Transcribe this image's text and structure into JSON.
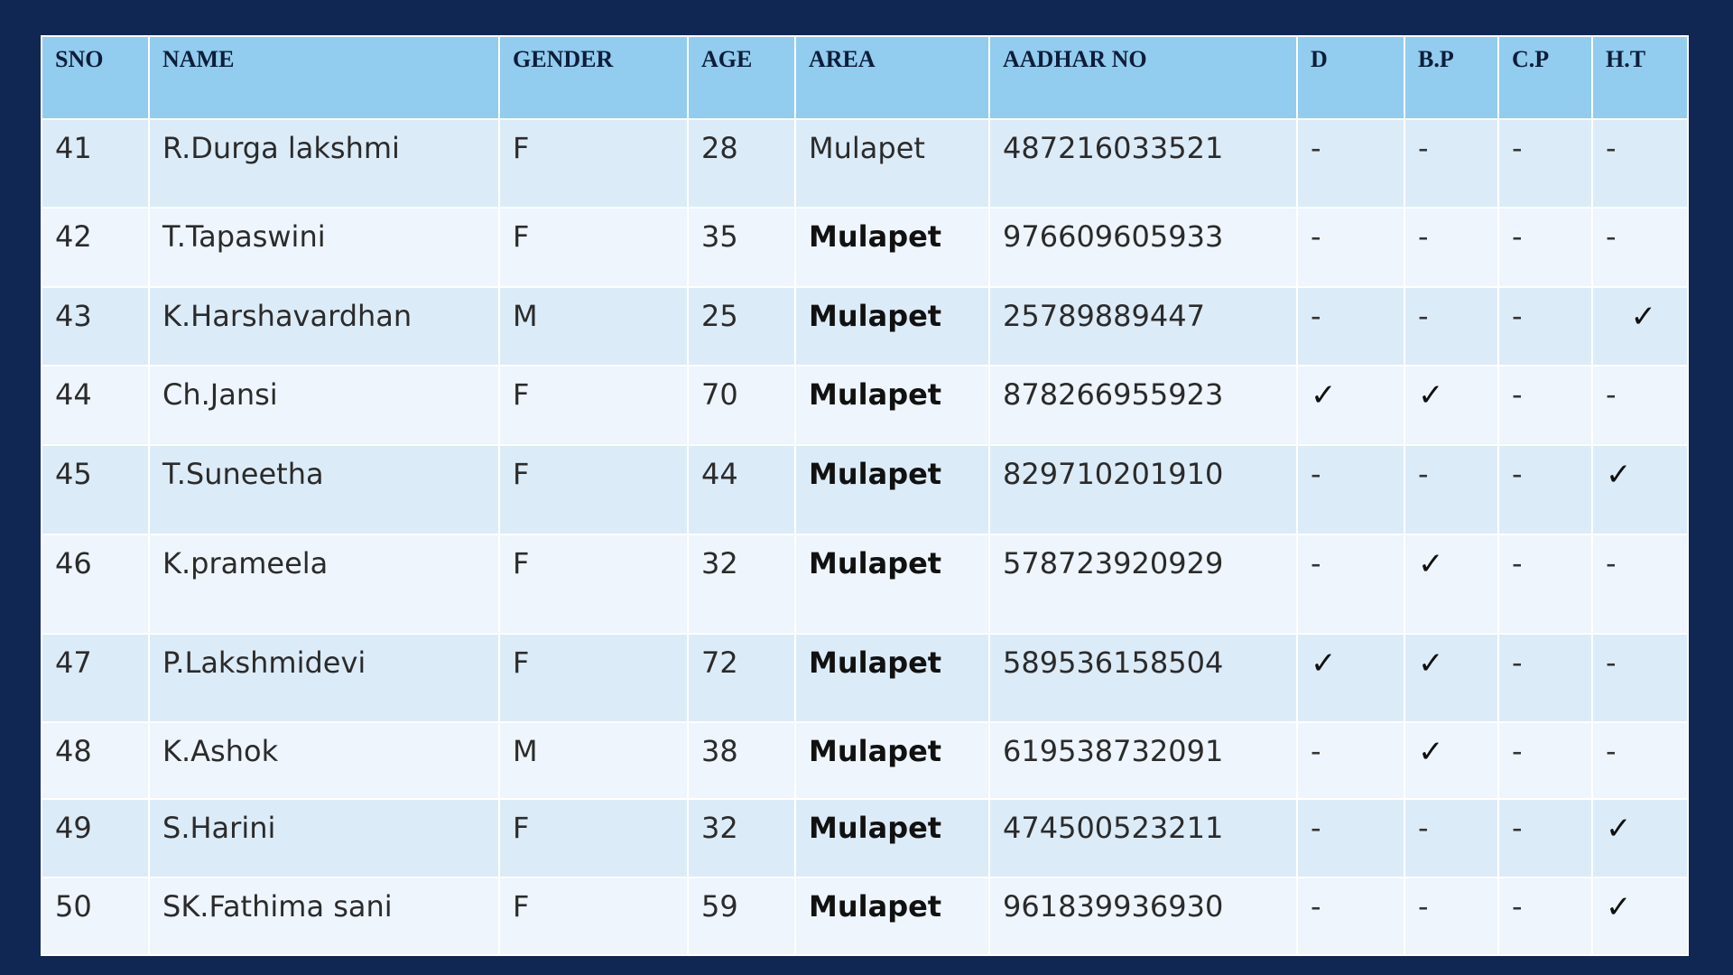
{
  "columns": [
    "SNO",
    "NAME",
    "GENDER",
    "AGE",
    "AREA",
    "AADHAR NO",
    "D",
    "B.P",
    "C.P",
    "H.T"
  ],
  "rows": [
    {
      "sno": "41",
      "name": "R.Durga lakshmi",
      "gender": "F",
      "age": "28",
      "area": "Mulapet",
      "area_bold": false,
      "aadhar": "487216033521",
      "d": "-",
      "bp": "-",
      "cp": "-",
      "ht": "-"
    },
    {
      "sno": "42",
      "name": "T.Tapaswini",
      "gender": "F",
      "age": "35",
      "area": "Mulapet",
      "area_bold": true,
      "aadhar": "976609605933",
      "d": "-",
      "bp": "-",
      "cp": "-",
      "ht": "-"
    },
    {
      "sno": "43",
      "name": "K.Harshavardhan",
      "gender": "M",
      "age": "25",
      "area": "Mulapet",
      "area_bold": true,
      "aadhar": "25789889447",
      "d": "-",
      "bp": "-",
      "cp": "-",
      "ht": "✓"
    },
    {
      "sno": "44",
      "name": "Ch.Jansi",
      "gender": "F",
      "age": "70",
      "area": "Mulapet",
      "area_bold": true,
      "aadhar": "878266955923",
      "d": "✓",
      "bp": "✓",
      "cp": "-",
      "ht": "-"
    },
    {
      "sno": "45",
      "name": "T.Suneetha",
      "gender": "F",
      "age": "44",
      "area": "Mulapet",
      "area_bold": true,
      "aadhar": "829710201910",
      "d": "-",
      "bp": "-",
      "cp": "-",
      "ht": "✓"
    },
    {
      "sno": "46",
      "name": "K.prameela",
      "gender": "F",
      "age": "32",
      "area": "Mulapet",
      "area_bold": true,
      "aadhar": "578723920929",
      "d": "-",
      "bp": "✓",
      "cp": "-",
      "ht": "-"
    },
    {
      "sno": "47",
      "name": "P.Lakshmidevi",
      "gender": "F",
      "age": "72",
      "area": "Mulapet",
      "area_bold": true,
      "aadhar": "589536158504",
      "d": "✓",
      "bp": "✓",
      "cp": "-",
      "ht": "-"
    },
    {
      "sno": "48",
      "name": "K.Ashok",
      "gender": "M",
      "age": "38",
      "area": "Mulapet",
      "area_bold": true,
      "aadhar": "619538732091",
      "d": "-",
      "bp": "✓",
      "cp": "-",
      "ht": "-"
    },
    {
      "sno": "49",
      "name": "S.Harini",
      "gender": "F",
      "age": "32",
      "area": "Mulapet",
      "area_bold": true,
      "aadhar": "474500523211",
      "d": "-",
      "bp": "-",
      "cp": "-",
      "ht": "✓"
    },
    {
      "sno": "50",
      "name": "SK.Fathima sani",
      "gender": "F",
      "age": "59",
      "area": "Mulapet",
      "area_bold": true,
      "aadhar": "961839936930",
      "d": "-",
      "bp": "-",
      "cp": "-",
      "ht": "✓"
    }
  ],
  "colors": {
    "background": "#102754",
    "header": "#92ccee",
    "row_odd": "#dcebf8",
    "row_even": "#eef5fc"
  }
}
